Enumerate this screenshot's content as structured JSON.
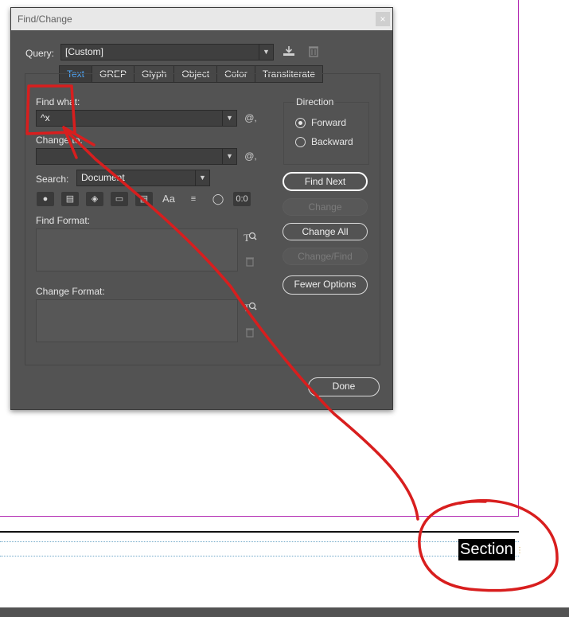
{
  "dialog": {
    "title": "Find/Change",
    "close_glyph": "×",
    "query": {
      "label": "Query:",
      "value": "[Custom]"
    },
    "tabs": [
      "Text",
      "GREP",
      "Glyph",
      "Object",
      "Color",
      "Transliterate"
    ],
    "active_tab": "Text",
    "find_what": {
      "label": "Find what:",
      "value": "^x"
    },
    "change_to": {
      "label": "Change to:",
      "value": ""
    },
    "at_glyph": "@,",
    "search": {
      "label": "Search:",
      "value": "Document"
    },
    "find_format": {
      "label": "Find Format:"
    },
    "change_format": {
      "label": "Change Format:"
    },
    "direction": {
      "label": "Direction",
      "options": [
        "Forward",
        "Backward"
      ],
      "selected": "Forward"
    },
    "buttons": {
      "find_next": "Find Next",
      "change": "Change",
      "change_all": "Change All",
      "change_find": "Change/Find",
      "fewer_options": "Fewer Options",
      "done": "Done"
    },
    "option_icons": [
      "locked-layers-icon",
      "locked-stories-icon",
      "hidden-layers-icon",
      "master-pages-icon",
      "footnotes-icon",
      "case-sensitive-icon",
      "whole-word-icon",
      "kana-sensitive-icon",
      "width-sensitive-icon"
    ],
    "case_label": "Aa",
    "width_label": "0:0"
  },
  "document": {
    "section_text": "Section"
  },
  "colors": {
    "annotation_red": "#d81e1e",
    "accent_blue": "#4ea3f2",
    "guide_magenta": "#b32cb3"
  }
}
